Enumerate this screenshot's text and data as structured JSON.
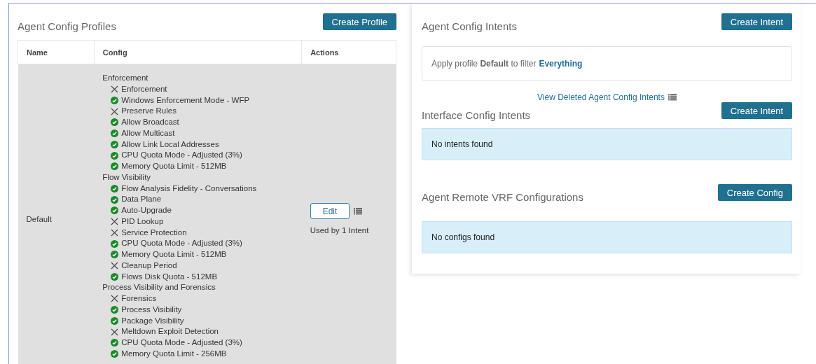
{
  "profiles": {
    "title": "Agent Config Profiles",
    "create_button": "Create Profile",
    "columns": [
      "Name",
      "Config",
      "Actions"
    ],
    "rows": [
      {
        "name": "Default",
        "selected": true,
        "edit_button": "Edit",
        "used_by": "Used by 1 Intent",
        "groups": [
          {
            "title": "Enforcement",
            "items": [
              {
                "label": "Enforcement",
                "enabled": false
              },
              {
                "label": "Windows Enforcement Mode - WFP",
                "enabled": true
              },
              {
                "label": "Preserve Rules",
                "enabled": false
              },
              {
                "label": "Allow Broadcast",
                "enabled": true
              },
              {
                "label": "Allow Multicast",
                "enabled": true
              },
              {
                "label": "Allow Link Local Addresses",
                "enabled": true
              },
              {
                "label": "CPU Quota Mode - Adjusted (3%)",
                "enabled": true
              },
              {
                "label": "Memory Quota Limit - 512MB",
                "enabled": true
              }
            ]
          },
          {
            "title": "Flow Visibility",
            "items": [
              {
                "label": "Flow Analysis Fidelity - Conversations",
                "enabled": true
              },
              {
                "label": "Data Plane",
                "enabled": true
              },
              {
                "label": "Auto-Upgrade",
                "enabled": true
              },
              {
                "label": "PID Lookup",
                "enabled": false
              },
              {
                "label": "Service Protection",
                "enabled": false
              },
              {
                "label": "CPU Quota Mode - Adjusted (3%)",
                "enabled": true
              },
              {
                "label": "Memory Quota Limit - 512MB",
                "enabled": true
              },
              {
                "label": "Cleanup Period",
                "enabled": false
              },
              {
                "label": "Flows Disk Quota - 512MB",
                "enabled": true
              }
            ]
          },
          {
            "title": "Process Visibility and Forensics",
            "items": [
              {
                "label": "Forensics",
                "enabled": false
              },
              {
                "label": "Process Visibility",
                "enabled": true
              },
              {
                "label": "Package Visibility",
                "enabled": true
              },
              {
                "label": "Meltdown Exploit Detection",
                "enabled": false
              },
              {
                "label": "CPU Quota Mode - Adjusted (3%)",
                "enabled": true
              },
              {
                "label": "Memory Quota Limit - 256MB",
                "enabled": true
              }
            ]
          }
        ]
      }
    ]
  },
  "intents": {
    "title": "Agent Config Intents",
    "create_button": "Create Intent",
    "items": [
      {
        "text": "Apply profile **Default** to filter",
        "link": "Everything"
      }
    ],
    "deleted_link": "View Deleted Agent Config Intents"
  },
  "interface_intents": {
    "title": "Interface Config Intents",
    "create_button": "Create Intent",
    "empty": "No intents found"
  },
  "remote_vrf": {
    "title": "Agent Remote VRF Configurations",
    "create_button": "Create Config",
    "empty": "No configs found"
  }
}
